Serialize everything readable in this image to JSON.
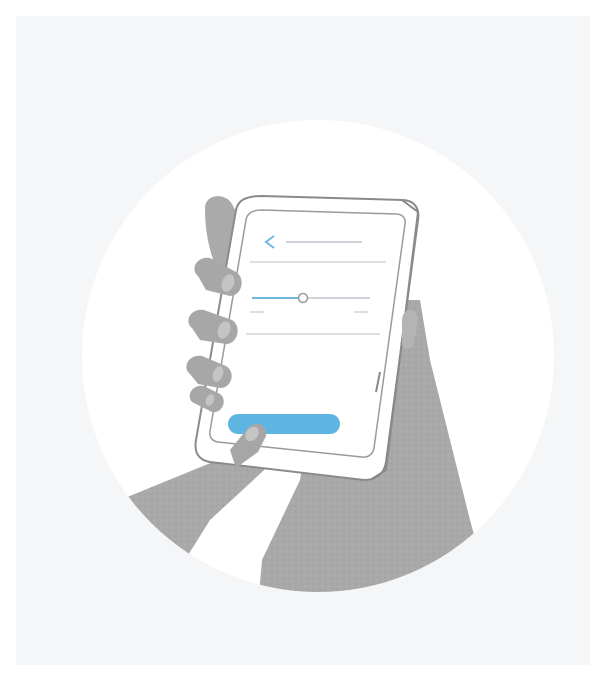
{
  "illustration": {
    "subject": "hand-holding-phone",
    "colors": {
      "panel": "#f5f6f8",
      "circle": "#ffffff",
      "hand": "#a9a9a9",
      "hand_light": "#bdbdbd",
      "outline": "#8a8a8a",
      "phone_body": "#ffffff",
      "screen_line": "#cfd4da",
      "accent_line": "#6fb6e0",
      "button": "#5fb5e2"
    },
    "icons": {
      "back": "chevron-left-icon"
    },
    "slider_level": 0.45
  }
}
